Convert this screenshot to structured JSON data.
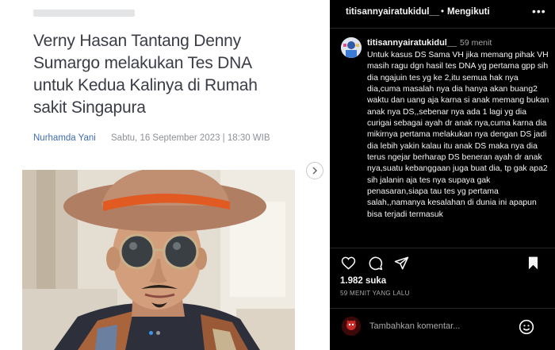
{
  "article": {
    "headline": "Verny Hasan Tantang Denny Sumargo melakukan Tes DNA untuk Kedua Kalinya di Rumah sakit Singapura",
    "author": "Nurhamda Yani",
    "date": "Sabtu, 16 September 2023 | 18:30 WIB"
  },
  "carousel": {
    "total_dots": 2,
    "active_index": 0
  },
  "header": {
    "username": "titisannyairatukidul__",
    "separator": "•",
    "follow_label": "Mengikuti",
    "more_label": "•••"
  },
  "caption": {
    "username": "titisannyairatukidul__",
    "time": "59 menit",
    "text": "Untuk kasus DS Sama VH jika memang pihak VH masih ragu dgn hasil tes DNA yg pertama gpp sih dia ngajuin tes yg ke 2,itu semua hak nya dia,cuma masalah nya dia hanya akan buang2 waktu dan uang aja karna si anak memang bukan anak nya DS,,sebenar nya ada 1 lagi yg dia curigai sebagai ayah dr anak nya,cuma karna dia mikirnya pertama melakukan nya dengan DS jadi dia lebih yakin kalau itu anak DS maka nya dia terus ngejar berharap DS beneran ayah dr anak nya,suatu kebanggaan juga buat dia, tp gak apa2 sih jalanin aja tes nya supaya gak penasaran,siapa tau tes yg pertama salah,,namanya kesalahan di dunia ini apapun bisa terjadi termasuk"
  },
  "actions": {
    "like_icon": "heart-icon",
    "comment_icon": "comment-icon",
    "share_icon": "send-icon",
    "save_icon": "bookmark-icon"
  },
  "stats": {
    "likes": "1.982 suka",
    "age": "59 MENIT YANG LALU"
  },
  "comment_box": {
    "placeholder": "Tambahkan komentar...",
    "emoji_icon": "smiley-icon"
  },
  "colors": {
    "panel_bg": "#000000",
    "author_link": "#3f6db4",
    "carousel_active": "#3897f0"
  }
}
